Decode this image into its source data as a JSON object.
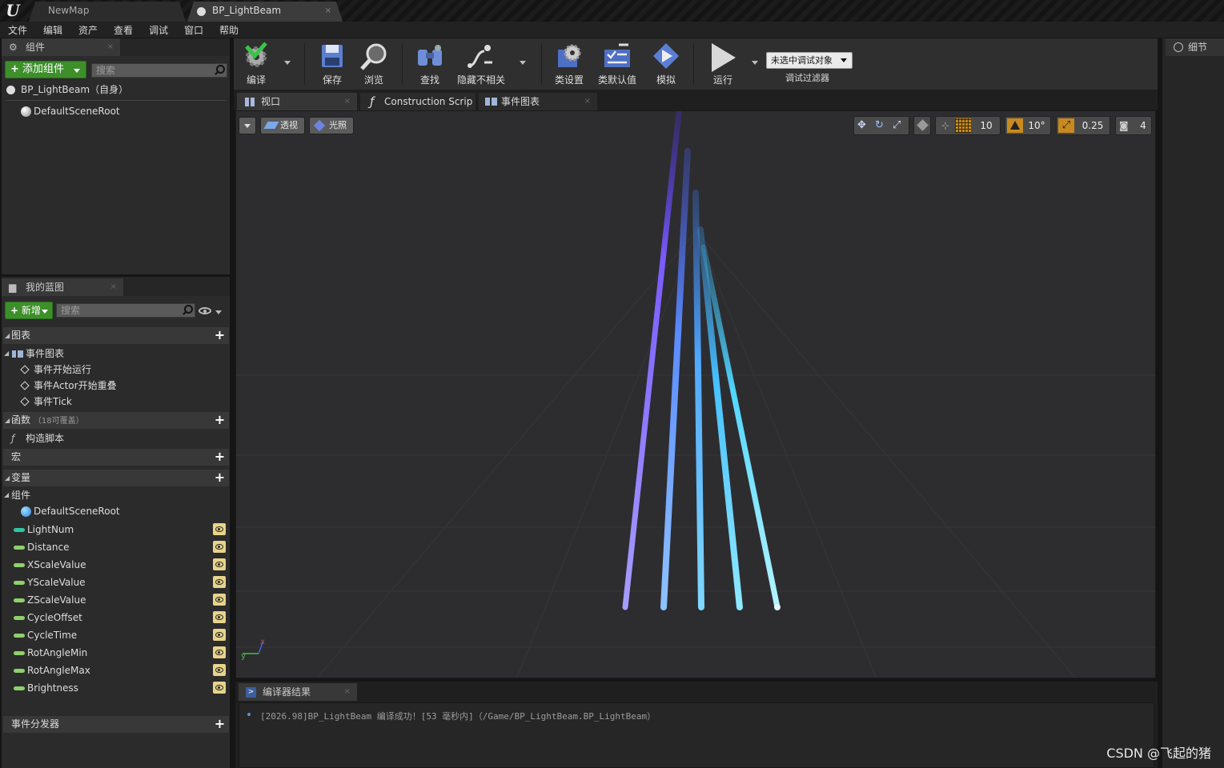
{
  "titlebar": {
    "tabs": [
      {
        "label": "NewMap"
      },
      {
        "label": "BP_LightBeam",
        "close": "×"
      }
    ]
  },
  "menu": [
    "文件",
    "编辑",
    "资产",
    "查看",
    "调试",
    "窗口",
    "帮助"
  ],
  "components": {
    "tab_label": "组件",
    "tab_close": "×",
    "add_button": "添加组件",
    "search_placeholder": "搜索",
    "root_self": "BP_LightBeam（自身）",
    "scene_root": "DefaultSceneRoot"
  },
  "toolbar": {
    "buttons": [
      "编译",
      "保存",
      "浏览",
      "查找",
      "隐藏不相关",
      "类设置",
      "类默认值",
      "模拟",
      "运行"
    ],
    "debug_object": "未选中调试对象",
    "debug_filter": "调试过滤器"
  },
  "editor_tabs": [
    {
      "label": "视口"
    },
    {
      "label": "Construction Scrip"
    },
    {
      "label": "事件图表"
    }
  ],
  "viewport": {
    "perspective": "透视",
    "lit": "光照",
    "grid_snap": "10",
    "rot_snap": "10°",
    "scale_snap": "0.25",
    "cam_speed": "4"
  },
  "my_blueprint": {
    "tab_label": "我的蓝图",
    "tab_close": "×",
    "new_button": "新增",
    "search_placeholder": "搜索",
    "sections": {
      "graphs": "图表",
      "event_graph": "事件图表",
      "events": [
        "事件开始运行",
        "事件Actor开始重叠",
        "事件Tick"
      ],
      "functions": "函数",
      "functions_note": "（18可覆盖）",
      "construction": "构造脚本",
      "macros": "宏",
      "variables": "变量",
      "components_cat": "组件",
      "scene_root": "DefaultSceneRoot",
      "dispatchers": "事件分发器"
    },
    "variables": [
      {
        "name": "LightNum",
        "color": "#2fc6a7"
      },
      {
        "name": "Distance",
        "color": "#8fd06c"
      },
      {
        "name": "XScaleValue",
        "color": "#8fd06c"
      },
      {
        "name": "YScaleValue",
        "color": "#8fd06c"
      },
      {
        "name": "ZScaleValue",
        "color": "#8fd06c"
      },
      {
        "name": "CycleOffset",
        "color": "#8fd06c"
      },
      {
        "name": "CycleTime",
        "color": "#8fd06c"
      },
      {
        "name": "RotAngleMin",
        "color": "#8fd06c"
      },
      {
        "name": "RotAngleMax",
        "color": "#8fd06c"
      },
      {
        "name": "Brightness",
        "color": "#8fd06c"
      }
    ]
  },
  "compiler": {
    "tab_label": "编译器结果",
    "message": "[2026.98]BP_LightBeam 编译成功！[53 毫秒内]（/Game/BP_LightBeam.BP_LightBeam）"
  },
  "details": {
    "tab_label": "细节"
  },
  "watermark": "CSDN @飞起的猪",
  "colors": {
    "accent_green": "#3d8f2a",
    "beam_purple": "#7a5cff",
    "beam_cyan": "#52d6ff"
  }
}
